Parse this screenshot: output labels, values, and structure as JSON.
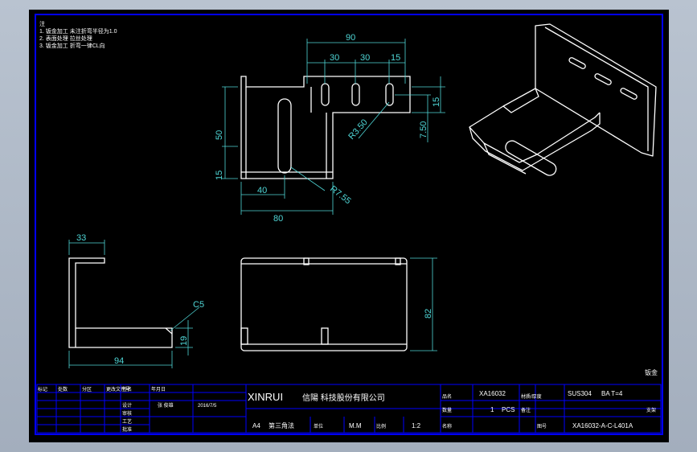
{
  "notes": {
    "header": "注",
    "lines": [
      "1. 钣金加工 未注折弯半径为1.0",
      "2. 表面处理 拉丝处理",
      "3. 钣金加工 折弯一律CL向"
    ]
  },
  "dimensions": {
    "d90": "90",
    "d30a": "30",
    "d30b": "30",
    "d15top": "15",
    "d15right": "15",
    "d750": "7.50",
    "dr350": "R3.50",
    "d50": "50",
    "d15left": "15",
    "d40": "40",
    "d80": "80",
    "dr755": "R7.55",
    "d33": "33",
    "dc5": "C5",
    "d19": "19",
    "d94": "94",
    "d82": "82"
  },
  "corner_label": "钣金",
  "title_block": {
    "rev_header": [
      "标记",
      "处数",
      "分区",
      "更改文件号",
      "签名",
      "年月日"
    ],
    "side_rows": [
      "设计",
      "审核",
      "工艺",
      "批准"
    ],
    "designer": "张 俊雄",
    "date": "2016/7/5",
    "company_en": "XINRUI",
    "company_cn": "信陽 科技股份有限公司",
    "size": "A4",
    "view": "第三角法",
    "unit_label": "单位",
    "unit": "M.M",
    "scale_label": "比例",
    "scale": "1:2",
    "part_label": "品名",
    "part_no": "XA16032",
    "material_label": "材质/厚度",
    "material": "SUS304",
    "thickness": "BA T=4",
    "qty_label": "数量",
    "qty": "1",
    "qty_unit": "PCS",
    "drawing_no_label": "图号",
    "drawing_no": "XA16032-A-C-L401A",
    "remark_label": "备注",
    "name_label": "名称",
    "name": "支架"
  }
}
